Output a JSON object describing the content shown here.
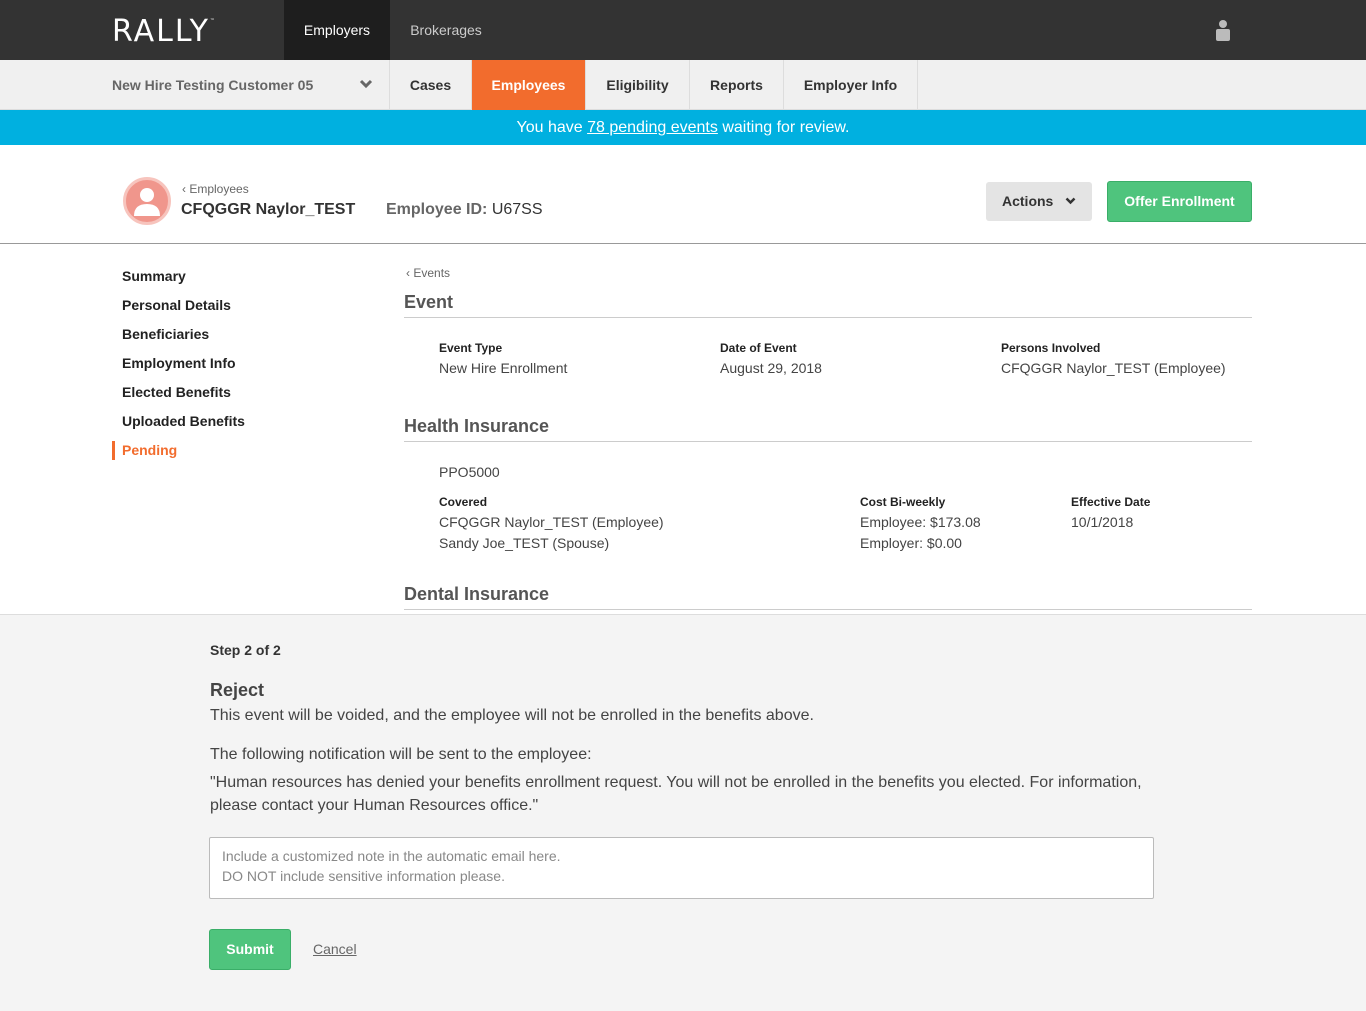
{
  "topbar": {
    "logo": "RALLY",
    "logo_tm": "™",
    "tabs": [
      {
        "label": "Employers",
        "active": true
      },
      {
        "label": "Brokerages",
        "active": false
      }
    ],
    "user_icon": "user-icon"
  },
  "subnav": {
    "customer": "New Hire Testing Customer 05",
    "tabs": [
      {
        "label": "Cases",
        "active": false
      },
      {
        "label": "Employees",
        "active": true
      },
      {
        "label": "Eligibility",
        "active": false
      },
      {
        "label": "Reports",
        "active": false
      },
      {
        "label": "Employer Info",
        "active": false
      }
    ],
    "active_color": "#f26c2d"
  },
  "banner": {
    "prefix": "You have ",
    "link": "78 pending events",
    "suffix": " waiting for review.",
    "color": "#00b0e0"
  },
  "employee": {
    "back_label": "Employees",
    "name": "CFQGGR Naylor_TEST",
    "id_label": "Employee ID:",
    "id_value": "U67SS",
    "actions_label": "Actions",
    "offer_label": "Offer Enrollment"
  },
  "leftnav": {
    "items": [
      {
        "label": "Summary",
        "active": false
      },
      {
        "label": "Personal Details",
        "active": false
      },
      {
        "label": "Beneficiaries",
        "active": false
      },
      {
        "label": "Employment Info",
        "active": false
      },
      {
        "label": "Elected Benefits",
        "active": false
      },
      {
        "label": "Uploaded Benefits",
        "active": false
      },
      {
        "label": "Pending",
        "active": true
      }
    ]
  },
  "main": {
    "crumb": "Events",
    "event": {
      "title": "Event",
      "type_label": "Event Type",
      "type_value": "New Hire Enrollment",
      "date_label": "Date of Event",
      "date_value": "August 29, 2018",
      "persons_label": "Persons Involved",
      "persons_value": "CFQGGR Naylor_TEST (Employee)"
    },
    "health": {
      "title": "Health Insurance",
      "plan": "PPO5000",
      "covered_label": "Covered",
      "covered": [
        "CFQGGR Naylor_TEST (Employee)",
        "Sandy Joe_TEST (Spouse)"
      ],
      "cost_label": "Cost Bi-weekly",
      "costs": [
        "Employee: $173.08",
        "Employer: $0.00"
      ],
      "effective_label": "Effective Date",
      "effective_value": "10/1/2018"
    },
    "dental": {
      "title": "Dental Insurance"
    }
  },
  "panel": {
    "step": "Step 2 of 2",
    "title": "Reject",
    "description": "This event will be voided, and the employee will not be enrolled in the benefits above.",
    "notification_intro": "The following notification will be sent to the employee:",
    "notification_line1": "\"Human resources has denied your benefits enrollment request. You will not be enrolled in the benefits you elected. For information,",
    "notification_line2": "please contact your Human Resources office.\"",
    "note_placeholder_line1": "Include a customized note in the automatic email here.",
    "note_placeholder_line2": "DO NOT include sensitive information please.",
    "submit_label": "Submit",
    "cancel_label": "Cancel"
  }
}
